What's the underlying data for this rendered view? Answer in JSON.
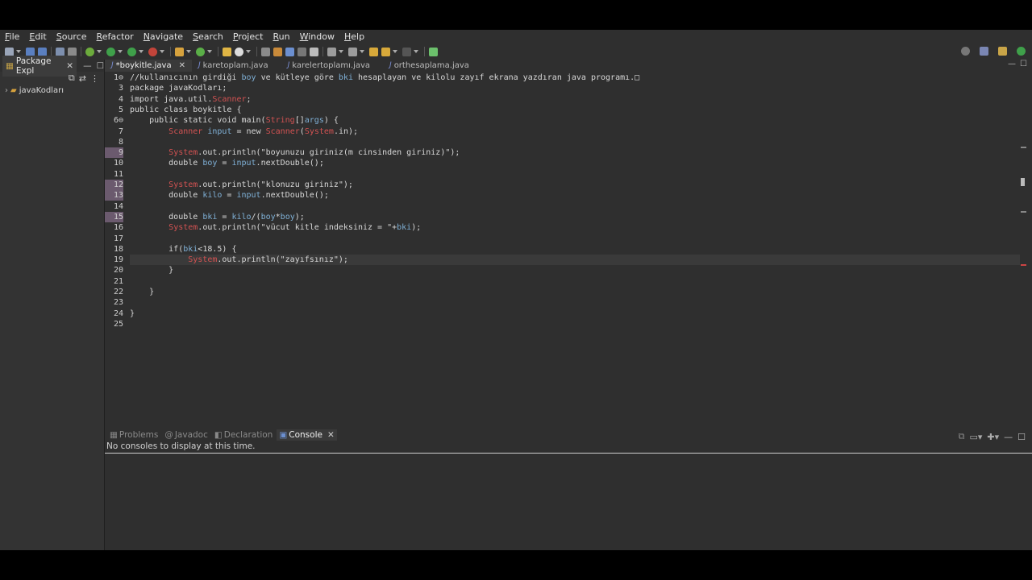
{
  "menu": [
    "File",
    "Edit",
    "Source",
    "Refactor",
    "Navigate",
    "Search",
    "Project",
    "Run",
    "Window",
    "Help"
  ],
  "left_panel": {
    "tab_label": "Package Expl",
    "tree": [
      {
        "label": "javaKodları"
      }
    ]
  },
  "editor": {
    "tabs": [
      {
        "label": "*boykitle.java",
        "active": true
      },
      {
        "label": "karetoplam.java",
        "active": false
      },
      {
        "label": "karelertoplamı.java",
        "active": false
      },
      {
        "label": "orthesaplama.java",
        "active": false
      }
    ],
    "lines": [
      {
        "num": "1⊖",
        "text": "//kullanıcının girdiği boy ve kütleye göre bki hesaplayan ve kilolu zayıf ekrana yazdıran java programı.□",
        "marked": false
      },
      {
        "num": "3",
        "text": "package javaKodları;",
        "marked": false
      },
      {
        "num": "4",
        "text": "import java.util.Scanner;",
        "marked": false
      },
      {
        "num": "5",
        "text": "public class boykitle {",
        "marked": false
      },
      {
        "num": "6⊖",
        "text": "    public static void main(String[]args) {",
        "marked": false
      },
      {
        "num": "7",
        "text": "        Scanner input = new Scanner(System.in);",
        "marked": false
      },
      {
        "num": "8",
        "text": "",
        "marked": false
      },
      {
        "num": "9",
        "text": "        System.out.println(\"boyunuzu giriniz(m cinsinden giriniz)\");",
        "marked": true
      },
      {
        "num": "10",
        "text": "        double boy = input.nextDouble();",
        "marked": false
      },
      {
        "num": "11",
        "text": "",
        "marked": false
      },
      {
        "num": "12",
        "text": "        System.out.println(\"klonuzu giriniz\");",
        "marked": true
      },
      {
        "num": "13",
        "text": "        double kilo = input.nextDouble();",
        "marked": true
      },
      {
        "num": "14",
        "text": "",
        "marked": false
      },
      {
        "num": "15",
        "text": "        double bki = kilo/(boy*boy);",
        "marked": true
      },
      {
        "num": "16",
        "text": "        System.out.println(\"vücut kitle indeksiniz = \"+bki);",
        "marked": false
      },
      {
        "num": "17",
        "text": "",
        "marked": false
      },
      {
        "num": "18",
        "text": "        if(bki<18.5) {",
        "marked": false
      },
      {
        "num": "19",
        "text": "            System.out.println(\"zayıfsınız\");",
        "marked": false
      },
      {
        "num": "20",
        "text": "        }",
        "marked": false
      },
      {
        "num": "21",
        "text": "",
        "marked": false
      },
      {
        "num": "22",
        "text": "    }",
        "marked": false
      },
      {
        "num": "23",
        "text": "",
        "marked": false
      },
      {
        "num": "24",
        "text": "}",
        "marked": false
      },
      {
        "num": "25",
        "text": "",
        "marked": false
      }
    ],
    "current_line_index": 17
  },
  "bottom_panel": {
    "tabs": [
      {
        "label": "Problems",
        "active": false
      },
      {
        "label": "Javadoc",
        "active": false
      },
      {
        "label": "Declaration",
        "active": false
      },
      {
        "label": "Console",
        "active": true
      }
    ],
    "console_message": "No consoles to display at this time."
  },
  "colors": {
    "background": "#2f2f2f",
    "keyword_red": "#d25252",
    "variable_blue": "#7fb0d6",
    "line_marker": "#6b5a6e"
  }
}
